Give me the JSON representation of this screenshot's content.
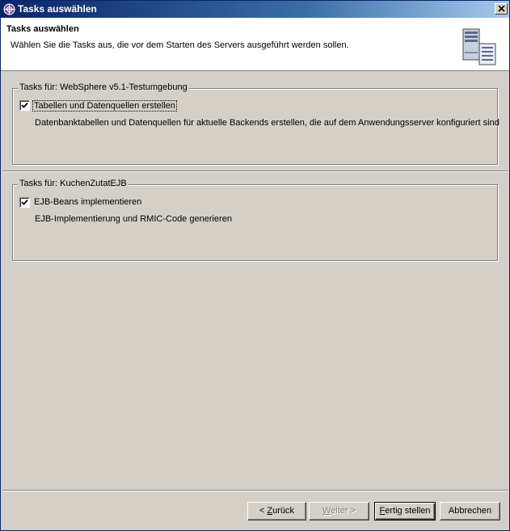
{
  "window": {
    "title": "Tasks auswählen",
    "close_label": "close"
  },
  "banner": {
    "title": "Tasks auswählen",
    "description": "Wählen Sie die Tasks aus, die vor dem Starten des Servers ausgeführt werden sollen.",
    "icon": "server-icon"
  },
  "groups": [
    {
      "legend": "Tasks für: WebSphere v5.1-Testumgebung",
      "task": {
        "label": "Tabellen und Datenquellen erstellen",
        "checked": true,
        "description": "Datenbanktabellen und Datenquellen für aktuelle Backends erstellen, die auf dem Anwendungsserver konfiguriert sind"
      }
    },
    {
      "legend": "Tasks für: KuchenZutatEJB",
      "task": {
        "label": "EJB-Beans implementieren",
        "checked": true,
        "description": "EJB-Implementierung und RMIC-Code generieren"
      }
    }
  ],
  "buttons": {
    "back": {
      "prefix": "< ",
      "mnemonic": "Z",
      "rest": "urück"
    },
    "next": {
      "mnemonic": "W",
      "rest": "eiter >",
      "enabled": false
    },
    "finish": {
      "mnemonic": "F",
      "rest": "ertig stellen"
    },
    "cancel": {
      "label": "Abbrechen"
    }
  },
  "colors": {
    "titlebar_start": "#0a246a",
    "titlebar_end": "#a6caf0",
    "dialog_bg": "#d4d0c8"
  }
}
